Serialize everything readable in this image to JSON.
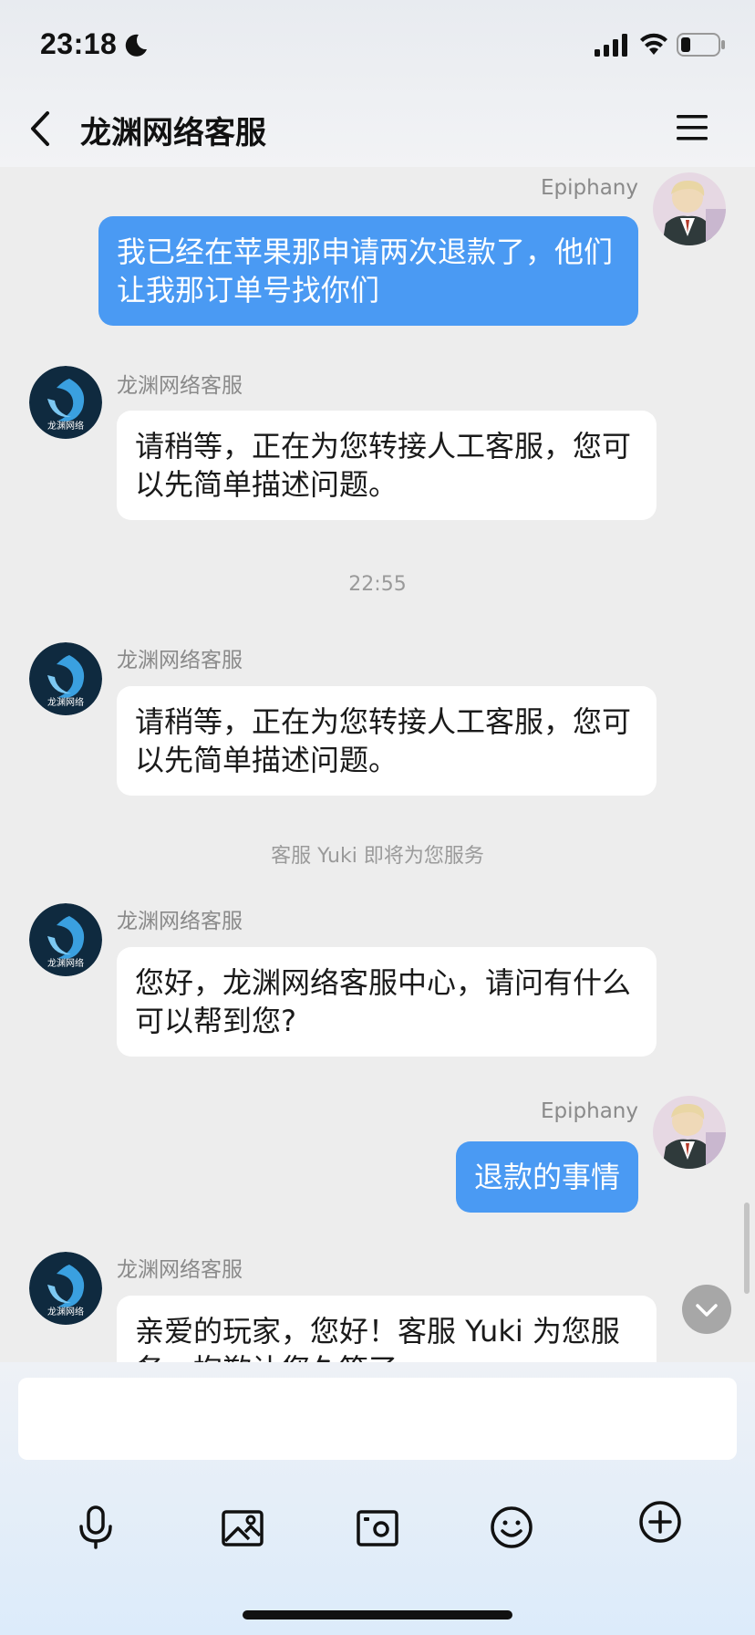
{
  "status_bar": {
    "time": "23:18"
  },
  "header": {
    "title": "龙渊网络客服"
  },
  "messages": [
    {
      "side": "mine",
      "sender": "Epiphany",
      "text": "我已经在苹果那申请两次退款了，他们让我那订单号找你们"
    },
    {
      "side": "theirs",
      "sender": "龙渊网络客服",
      "text": "请稍等，正在为您转接人工客服，您可以先简单描述问题。"
    },
    {
      "divider": "22:55"
    },
    {
      "side": "theirs",
      "sender": "龙渊网络客服",
      "text": "请稍等，正在为您转接人工客服，您可以先简单描述问题。"
    },
    {
      "notice": "客服 Yuki 即将为您服务"
    },
    {
      "side": "theirs",
      "sender": "龙渊网络客服",
      "text": "您好，龙渊网络客服中心，请问有什么可以帮到您?"
    },
    {
      "side": "mine",
      "sender": "Epiphany",
      "text": "退款的事情"
    },
    {
      "side": "theirs",
      "sender": "龙渊网络客服",
      "text": "亲爱的玩家，您好！客服 Yuki 为您服务，抱歉让您久等了"
    }
  ],
  "avatar_text": "龙渊网络",
  "input": {
    "value": "",
    "placeholder": ""
  },
  "toolbar": [
    "microphone-icon",
    "image-icon",
    "camera-icon",
    "emoji-icon",
    "plus-icon"
  ],
  "colors": {
    "my_bubble": "#4a9af3",
    "their_bubble": "#ffffff",
    "background": "#ededed"
  }
}
